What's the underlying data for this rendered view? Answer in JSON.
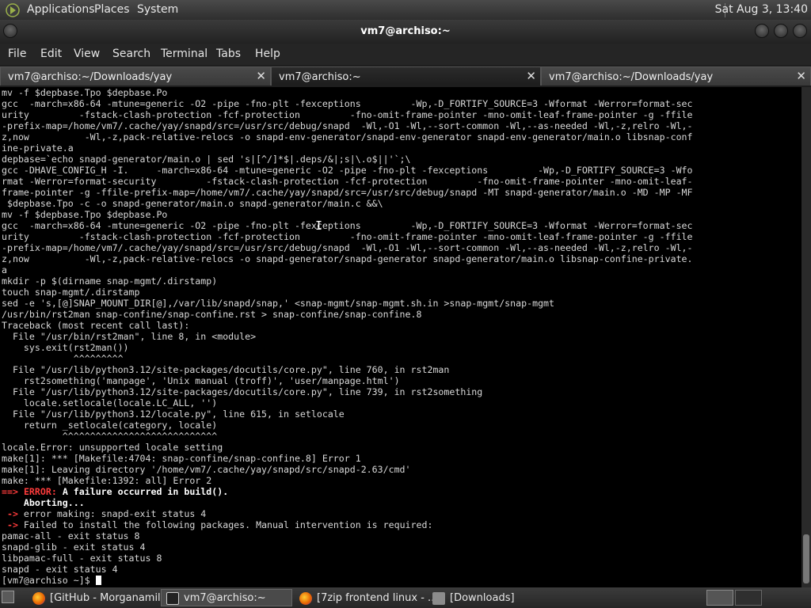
{
  "top_panel": {
    "menus": [
      "Applications",
      "Places",
      "System"
    ],
    "clock": "Sat Aug  3, 13:40"
  },
  "window": {
    "title": "vm7@archiso:~",
    "menu": [
      "File",
      "Edit",
      "View",
      "Search",
      "Terminal",
      "Tabs",
      "Help"
    ]
  },
  "tabs": [
    {
      "label": "vm7@archiso:~/Downloads/yay",
      "close": "✕"
    },
    {
      "label": "vm7@archiso:~",
      "close": "✕"
    },
    {
      "label": "vm7@archiso:~/Downloads/yay",
      "close": "✕"
    }
  ],
  "terminal": {
    "lines": [
      "mv -f $depbase.Tpo $depbase.Po",
      "gcc  -march=x86-64 -mtune=generic -O2 -pipe -fno-plt -fexceptions         -Wp,-D_FORTIFY_SOURCE=3 -Wformat -Werror=format-sec",
      "urity         -fstack-clash-protection -fcf-protection         -fno-omit-frame-pointer -mno-omit-leaf-frame-pointer -g -ffile",
      "-prefix-map=/home/vm7/.cache/yay/snapd/src=/usr/src/debug/snapd  -Wl,-O1 -Wl,--sort-common -Wl,--as-needed -Wl,-z,relro -Wl,-",
      "z,now          -Wl,-z,pack-relative-relocs -o snapd-env-generator/snapd-env-generator snapd-env-generator/main.o libsnap-conf",
      "ine-private.a",
      "depbase=`echo snapd-generator/main.o | sed 's|[^/]*$|.deps/&|;s|\\.o$||'`;\\",
      "gcc -DHAVE_CONFIG_H -I.     -march=x86-64 -mtune=generic -O2 -pipe -fno-plt -fexceptions         -Wp,-D_FORTIFY_SOURCE=3 -Wfo",
      "rmat -Werror=format-security         -fstack-clash-protection -fcf-protection         -fno-omit-frame-pointer -mno-omit-leaf-",
      "frame-pointer -g -ffile-prefix-map=/home/vm7/.cache/yay/snapd/src=/usr/src/debug/snapd -MT snapd-generator/main.o -MD -MP -MF",
      " $depbase.Tpo -c -o snapd-generator/main.o snapd-generator/main.c &&\\",
      "mv -f $depbase.Tpo $depbase.Po",
      "gcc  -march=x86-64 -mtune=generic -O2 -pipe -fno-plt -fexceptions         -Wp,-D_FORTIFY_SOURCE=3 -Wformat -Werror=format-sec",
      "urity         -fstack-clash-protection -fcf-protection         -fno-omit-frame-pointer -mno-omit-leaf-frame-pointer -g -ffile",
      "-prefix-map=/home/vm7/.cache/yay/snapd/src=/usr/src/debug/snapd  -Wl,-O1 -Wl,--sort-common -Wl,--as-needed -Wl,-z,relro -Wl,-",
      "z,now          -Wl,-z,pack-relative-relocs -o snapd-generator/snapd-generator snapd-generator/main.o libsnap-confine-private.",
      "a",
      "mkdir -p $(dirname snap-mgmt/.dirstamp)",
      "touch snap-mgmt/.dirstamp",
      "sed -e 's,[@]SNAP_MOUNT_DIR[@],/var/lib/snapd/snap,' <snap-mgmt/snap-mgmt.sh.in >snap-mgmt/snap-mgmt",
      "/usr/bin/rst2man snap-confine/snap-confine.rst > snap-confine/snap-confine.8",
      "Traceback (most recent call last):",
      "  File \"/usr/bin/rst2man\", line 8, in <module>",
      "    sys.exit(rst2man())",
      "             ^^^^^^^^^",
      "  File \"/usr/lib/python3.12/site-packages/docutils/core.py\", line 760, in rst2man",
      "    rst2something('manpage', 'Unix manual (troff)', 'user/manpage.html')",
      "  File \"/usr/lib/python3.12/site-packages/docutils/core.py\", line 739, in rst2something",
      "    locale.setlocale(locale.LC_ALL, '')",
      "  File \"/usr/lib/python3.12/locale.py\", line 615, in setlocale",
      "    return _setlocale(category, locale)",
      "           ^^^^^^^^^^^^^^^^^^^^^^^^^^^^",
      "locale.Error: unsupported locale setting",
      "make[1]: *** [Makefile:4704: snap-confine/snap-confine.8] Error 1",
      "make[1]: Leaving directory '/home/vm7/.cache/yay/snapd/src/snapd-2.63/cmd'",
      "make: *** [Makefile:1392: all] Error 2"
    ],
    "error_arrow": "==>",
    "error_label": "ERROR:",
    "error_msg": "A failure occurred in build().",
    "aborting": "    Aborting...",
    "error_making_arrow": " ->",
    "error_making": " error making: snapd-exit status 4",
    "failed_arrow": " ->",
    "failed_install": " Failed to install the following packages. Manual intervention is required:",
    "status_lines": [
      "pamac-all - exit status 8",
      "snapd-glib - exit status 4",
      "libpamac-full - exit status 8",
      "snapd - exit status 4"
    ],
    "prompt": "[vm7@archiso ~]$ "
  },
  "taskbar": {
    "items": [
      {
        "label": "[GitHub - Morganamil...",
        "icon": "firefox-icon"
      },
      {
        "label": "vm7@archiso:~",
        "icon": "terminal-icon"
      },
      {
        "label": "[7zip frontend linux - ...",
        "icon": "firefox-icon"
      },
      {
        "label": "[Downloads]",
        "icon": "folder-icon"
      }
    ]
  }
}
